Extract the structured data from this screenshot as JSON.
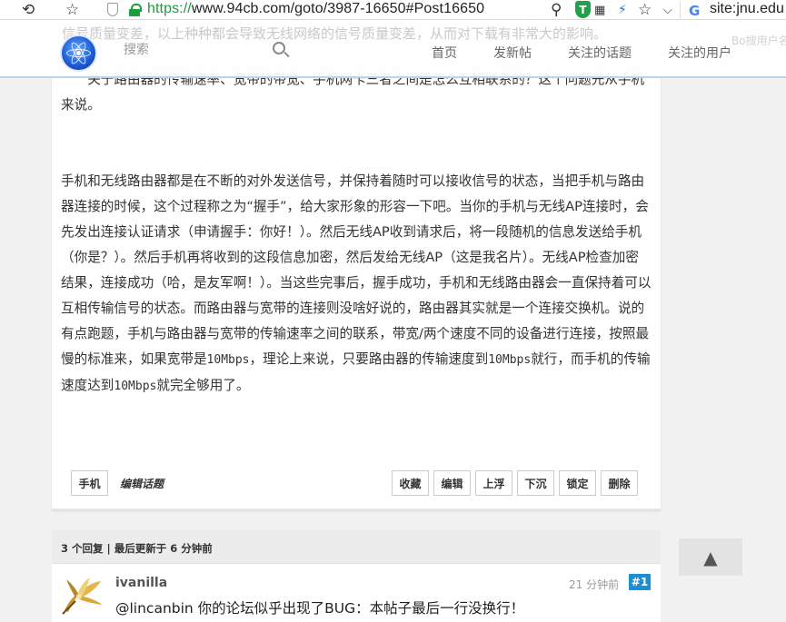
{
  "browser": {
    "url_scheme": "https://",
    "url_rest": "www.94cb.com/goto/3987-16650#Post16650",
    "search_text": "site:jnu.edu",
    "green_shield_label": "T",
    "icons": [
      "back-icon",
      "star-icon",
      "shield-outline-icon",
      "lock-icon",
      "magnifier-icon",
      "green-shield-icon",
      "qr-icon",
      "bolt-icon",
      "star-icon",
      "chevron-down-icon",
      "google-icon"
    ]
  },
  "header": {
    "ghost_text": "信号质量变差，以上种种都会导致无线网络的信号质量变差，从而对下载有非常大的影响。",
    "ghost_right": "Bo搜用户名址",
    "search_placeholder": "搜索",
    "nav": [
      "首页",
      "发新帖",
      "关注的话题",
      "关注的用户"
    ]
  },
  "post": {
    "intro": "关于路由器的传输速率、宽带的带宽、手机网卡三者之间是怎么互相联系的？这个问题先从手机来说。",
    "body": "手机和无线路由器都是在不断的对外发送信号，并保持着随时可以接收信号的状态，当把手机与路由器连接的时候，这个过程称之为“握手”，给大家形象的形容一下吧。当你的手机与无线AP连接时，会先发出连接认证请求（申请握手：你好！）。然后无线AP收到请求后，将一段随机的信息发送给手机（你是？）。然后手机再将收到的这段信息加密，然后发给无线AP（这是我名片）。无线AP检查加密结果，连接成功（哈，是友军啊！）。当这些完事后，握手成功，手机和无线路由器会一直保持着可以互相传输信号的状态。而路由器与宽带的连接则没啥好说的，路由器其实就是一个连接交换机。说的有点跑题，手机与路由器与宽带的传输速率之间的联系，带宽/两个速度不同的设备进行连接，按照最慢的标准来，如果宽带是",
    "body_mono_1": "10Mbps",
    "body_mid": "，理论上来说，只要路由器的传输速度到",
    "body_mono_2": "10Mbps",
    "body_mid_2": "就行，而手机的传输速度达到",
    "body_mono_3": "10Mbps",
    "body_end": "就完全够用了。",
    "tag": "手机",
    "edit_topic": "编辑话题",
    "actions": [
      "收藏",
      "编辑",
      "上浮",
      "下沉",
      "锁定",
      "删除"
    ]
  },
  "replies": {
    "summary": "3 个回复 | 最后更新于 6 分钟前",
    "items": [
      {
        "user": "ivanilla",
        "time": "21 分钟前",
        "floor": "#1",
        "text": "@lincanbin 你的论坛似乎出现了BUG：本帖子最后一行没换行！"
      }
    ]
  },
  "scroll_top": "▲",
  "colors": {
    "accent": "#1a8fd8",
    "secure_green": "#1a9e3a"
  }
}
